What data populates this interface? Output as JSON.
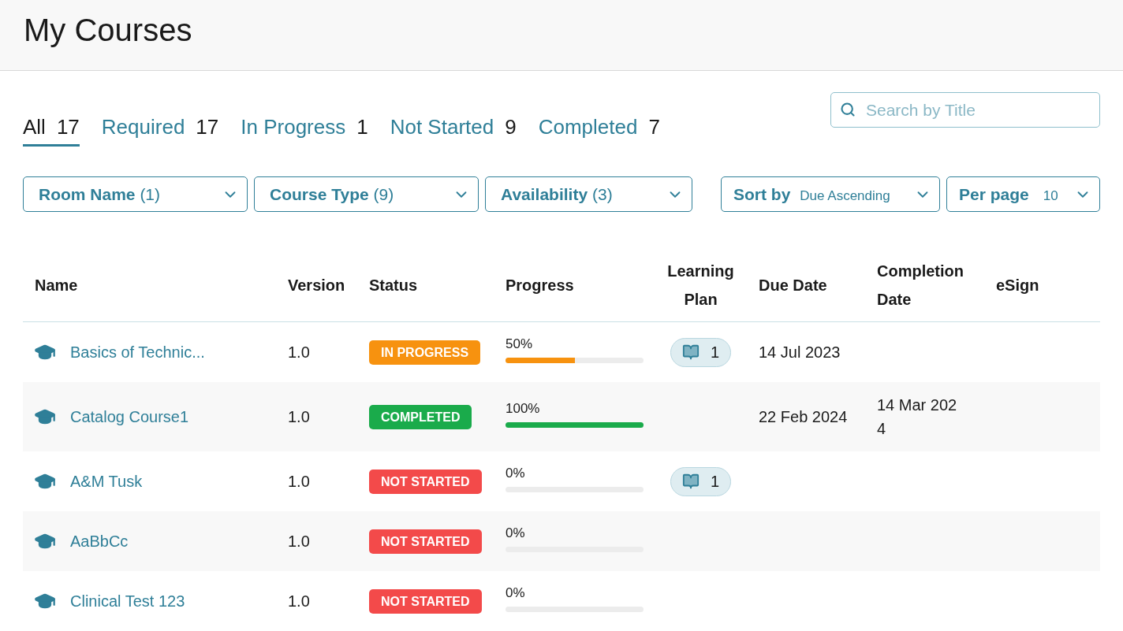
{
  "page_title": "My Courses",
  "tabs": [
    {
      "label": "All",
      "count": "17",
      "selected": true
    },
    {
      "label": "Required",
      "count": "17",
      "selected": false
    },
    {
      "label": "In Progress",
      "count": "1",
      "selected": false
    },
    {
      "label": "Not Started",
      "count": "9",
      "selected": false
    },
    {
      "label": "Completed",
      "count": "7",
      "selected": false
    }
  ],
  "search": {
    "placeholder": "Search by Title"
  },
  "filters": [
    {
      "label": "Room Name",
      "count": "(1)"
    },
    {
      "label": "Course Type",
      "count": "(9)"
    },
    {
      "label": "Availability",
      "count": "(3)"
    }
  ],
  "sort": {
    "label": "Sort by",
    "value": "Due Ascending"
  },
  "per_page": {
    "label": "Per page",
    "value": "10"
  },
  "table": {
    "columns": [
      "Name",
      "Version",
      "Status",
      "Progress",
      "Learning Plan",
      "Due Date",
      "Completion Date",
      "eSign"
    ],
    "rows": [
      {
        "name": "Basics of Technic...",
        "version": "1.0",
        "status": "IN PROGRESS",
        "kind": "in_progress",
        "progress": "50%",
        "level": 0.5,
        "learning_plan": "1",
        "due_date": "14 Jul 2023"
      },
      {
        "name": "Catalog Course1",
        "version": "1.0",
        "status": "COMPLETED",
        "kind": "completed",
        "progress": "100%",
        "level": 1,
        "due_date": "22 Feb 2024",
        "completion_date": "14 Mar 2024"
      },
      {
        "name": "A&M Tusk",
        "version": "1.0",
        "status": "NOT STARTED",
        "kind": "not_started",
        "progress": "0%",
        "level": 0,
        "learning_plan": "1"
      },
      {
        "name": "AaBbCc",
        "version": "1.0",
        "status": "NOT STARTED",
        "kind": "not_started",
        "progress": "0%",
        "level": 0
      },
      {
        "name": "Clinical Test 123",
        "version": "1.0",
        "status": "NOT STARTED",
        "kind": "not_started",
        "progress": "0%",
        "level": 0
      }
    ]
  }
}
